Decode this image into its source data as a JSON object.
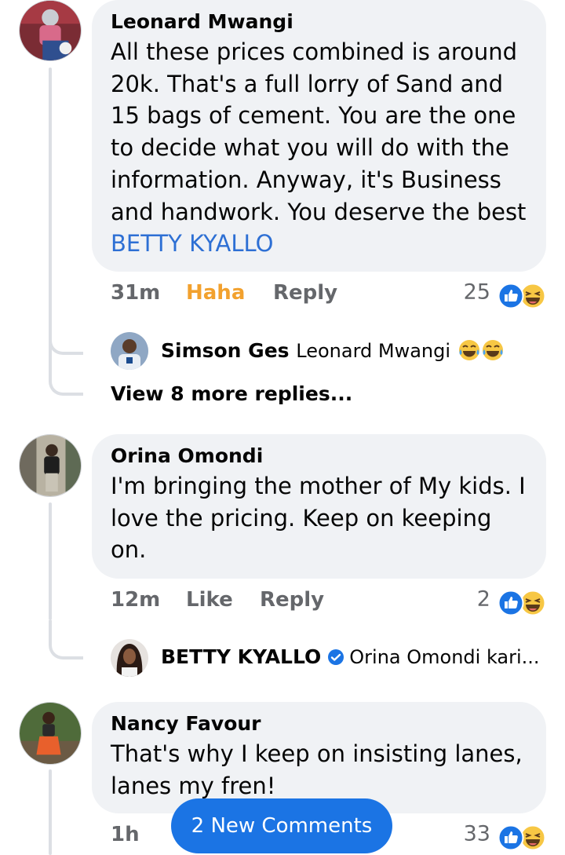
{
  "comments": [
    {
      "author": "Leonard Mwangi",
      "text": "All these prices combined is around 20k. That's a full lorry of Sand and 15 bags of cement. You are the one to decide what you will do with the information. Anyway, it's Business and handwork. You deserve the best",
      "mention": "BETTY KYALLO",
      "time": "31m",
      "like_label": "Haha",
      "reply_label": "Reply",
      "reaction_count": "25",
      "reactions": [
        "like-icon",
        "haha-icon"
      ],
      "replies": [
        {
          "author": "Simson Ges",
          "text": "Leonard Mwangi",
          "emoji": [
            "tears-of-joy-emoji",
            "tears-of-joy-emoji"
          ]
        }
      ],
      "view_more": "View 8 more replies..."
    },
    {
      "author": "Orina Omondi",
      "text": "I'm bringing the mother of My kids. I love the pricing. Keep on keeping on.",
      "time": "12m",
      "like_label": "Like",
      "reply_label": "Reply",
      "reaction_count": "2",
      "reactions": [
        "like-icon",
        "haha-icon"
      ],
      "replies": [
        {
          "author": "BETTY KYALLO",
          "verified": true,
          "text": "Orina Omondi kari..."
        }
      ]
    },
    {
      "author": "Nancy Favour",
      "text": "That's why I keep on insisting lanes, lanes my fren!",
      "time": "1h",
      "reaction_count": "33",
      "reactions": [
        "like-icon",
        "haha-icon"
      ]
    }
  ],
  "new_comments_button": "2 New Comments",
  "colors": {
    "bubble": "#f0f2f5",
    "link": "#2d6fd4",
    "haha": "#f2a12e",
    "primary": "#1b74e4",
    "meta": "#65676b"
  }
}
